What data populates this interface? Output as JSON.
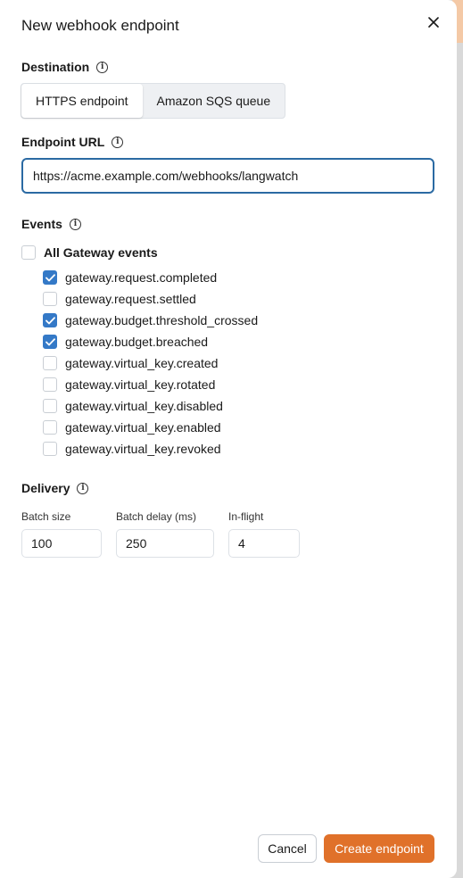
{
  "dialog": {
    "title": "New webhook endpoint"
  },
  "destination": {
    "label": "Destination",
    "options": [
      "HTTPS endpoint",
      "Amazon SQS queue"
    ],
    "selected": "HTTPS endpoint"
  },
  "endpoint": {
    "label": "Endpoint URL",
    "value": "https://acme.example.com/webhooks/langwatch"
  },
  "events": {
    "label": "Events",
    "all_label": "All Gateway events",
    "all_checked": false,
    "items": [
      {
        "label": "gateway.request.completed",
        "checked": true
      },
      {
        "label": "gateway.request.settled",
        "checked": false
      },
      {
        "label": "gateway.budget.threshold_crossed",
        "checked": true
      },
      {
        "label": "gateway.budget.breached",
        "checked": true
      },
      {
        "label": "gateway.virtual_key.created",
        "checked": false
      },
      {
        "label": "gateway.virtual_key.rotated",
        "checked": false
      },
      {
        "label": "gateway.virtual_key.disabled",
        "checked": false
      },
      {
        "label": "gateway.virtual_key.enabled",
        "checked": false
      },
      {
        "label": "gateway.virtual_key.revoked",
        "checked": false
      }
    ]
  },
  "delivery": {
    "label": "Delivery",
    "batch_size": {
      "label": "Batch size",
      "value": "100"
    },
    "batch_delay": {
      "label": "Batch delay (ms)",
      "value": "250"
    },
    "in_flight": {
      "label": "In-flight",
      "value": "4"
    }
  },
  "actions": {
    "cancel": "Cancel",
    "create": "Create endpoint"
  },
  "colors": {
    "accent": "#e0712a",
    "focus": "#2b6aa3",
    "checkbox": "#3479c7"
  },
  "icons": {
    "close": "close-icon",
    "info": "info-icon",
    "check": "check-icon"
  }
}
